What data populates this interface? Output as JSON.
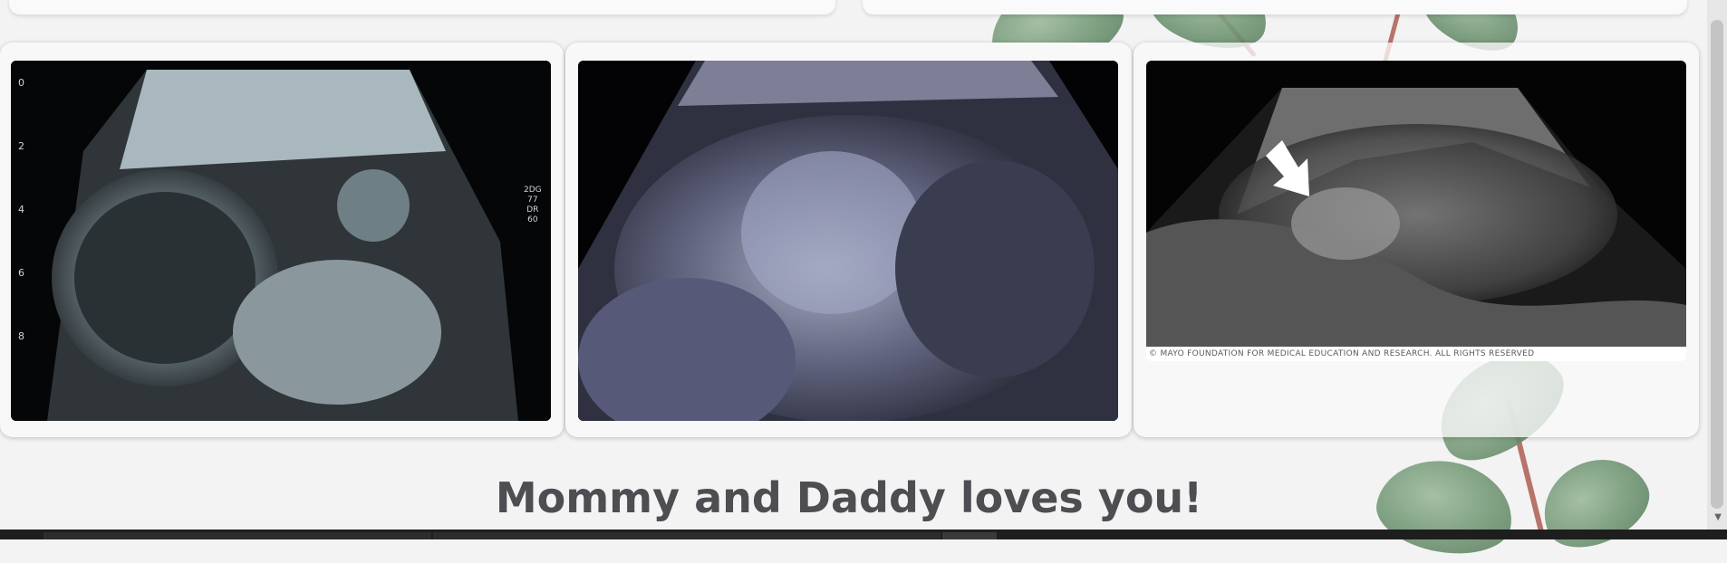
{
  "gallery": {
    "images": [
      {
        "alt": "Ultrasound side profile"
      },
      {
        "alt": "Ultrasound 3D face"
      },
      {
        "alt": "Ultrasound baby foot",
        "caption": "© MAYO FOUNDATION FOR MEDICAL EDUCATION AND RESEARCH. ALL RIGHTS RESERVED"
      }
    ]
  },
  "message": "Mommy and Daddy loves you!",
  "ultrasound_scale": [
    "0",
    "2",
    "4",
    "6",
    "8"
  ],
  "ultrasound_side": [
    "2DG",
    "77",
    "DR",
    "60"
  ]
}
